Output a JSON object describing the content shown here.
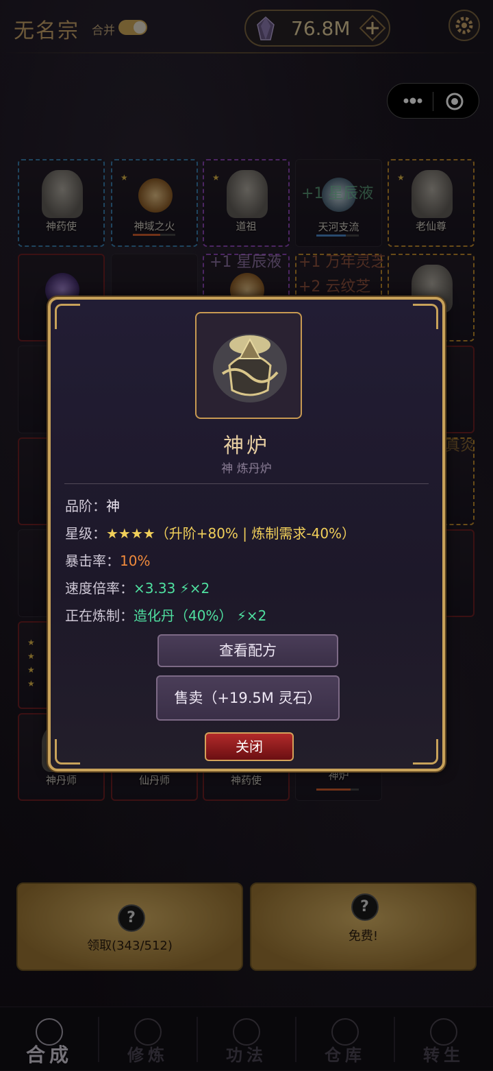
{
  "header": {
    "sect_name": "无名宗",
    "merge_label": "合并",
    "merge_enabled": true,
    "currency_value": "76.8M",
    "currency_icon": "spirit-crystal-icon"
  },
  "grid": {
    "cells": [
      {
        "label": "神药使",
        "color": "blue"
      },
      {
        "label": "神域之火",
        "color": "blue",
        "stars": "★"
      },
      {
        "label": "道祖",
        "color": "purple",
        "stars": "★"
      },
      {
        "label": "天河支流",
        "color": "plain"
      },
      {
        "label": "老仙尊",
        "color": "gold",
        "stars": "★"
      },
      {
        "label": "神丹师",
        "color": "red"
      },
      {
        "label": "仙丹师",
        "color": "red"
      },
      {
        "label": "神药使",
        "color": "red"
      },
      {
        "label": "神炉",
        "color": "plain"
      }
    ],
    "floating_texts": [
      "+1 星辰液",
      "+1 星辰液",
      "+1 万年灵芝",
      "+2 云纹芝",
      "真炎"
    ],
    "side_stars": "★"
  },
  "modal": {
    "item_name": "神炉",
    "item_subtitle": "神 炼丹炉",
    "stats": {
      "grade_label": "品阶：",
      "grade_value": "神",
      "star_label": "星级：",
      "star_icons": "★★★★",
      "star_bonus": "（升阶+80% | 炼制需求-40%）",
      "crit_label": "暴击率：",
      "crit_value": "10%",
      "speed_label": "速度倍率：",
      "speed_value": "×3.33",
      "speed_boost": "⚡×2",
      "crafting_label": "正在炼制：",
      "crafting_value": "造化丹（40%）",
      "crafting_boost": "⚡×2"
    },
    "buttons": {
      "recipe": "查看配方",
      "sell": "售卖（+19.5M 灵石）",
      "close": "关闭"
    }
  },
  "bottom_buttons": {
    "claim": "领取(343/512)",
    "free": "免费!"
  },
  "nav": {
    "items": [
      {
        "label": "合成",
        "icon": "swirl-icon",
        "active": true
      },
      {
        "label": "修炼",
        "icon": "meditation-icon",
        "active": false
      },
      {
        "label": "功法",
        "icon": "emblem-icon",
        "active": false
      },
      {
        "label": "仓库",
        "icon": "chest-icon",
        "active": false
      },
      {
        "label": "转生",
        "icon": "spiral-icon",
        "active": false
      }
    ]
  },
  "colors": {
    "gold_accent": "#c8a25a",
    "modal_bg": "#1d1829",
    "close_red": "#b22a2a",
    "stat_gold": "#f1cf5a",
    "stat_green": "#4fe0a0",
    "stat_orange": "#f08a3c"
  }
}
